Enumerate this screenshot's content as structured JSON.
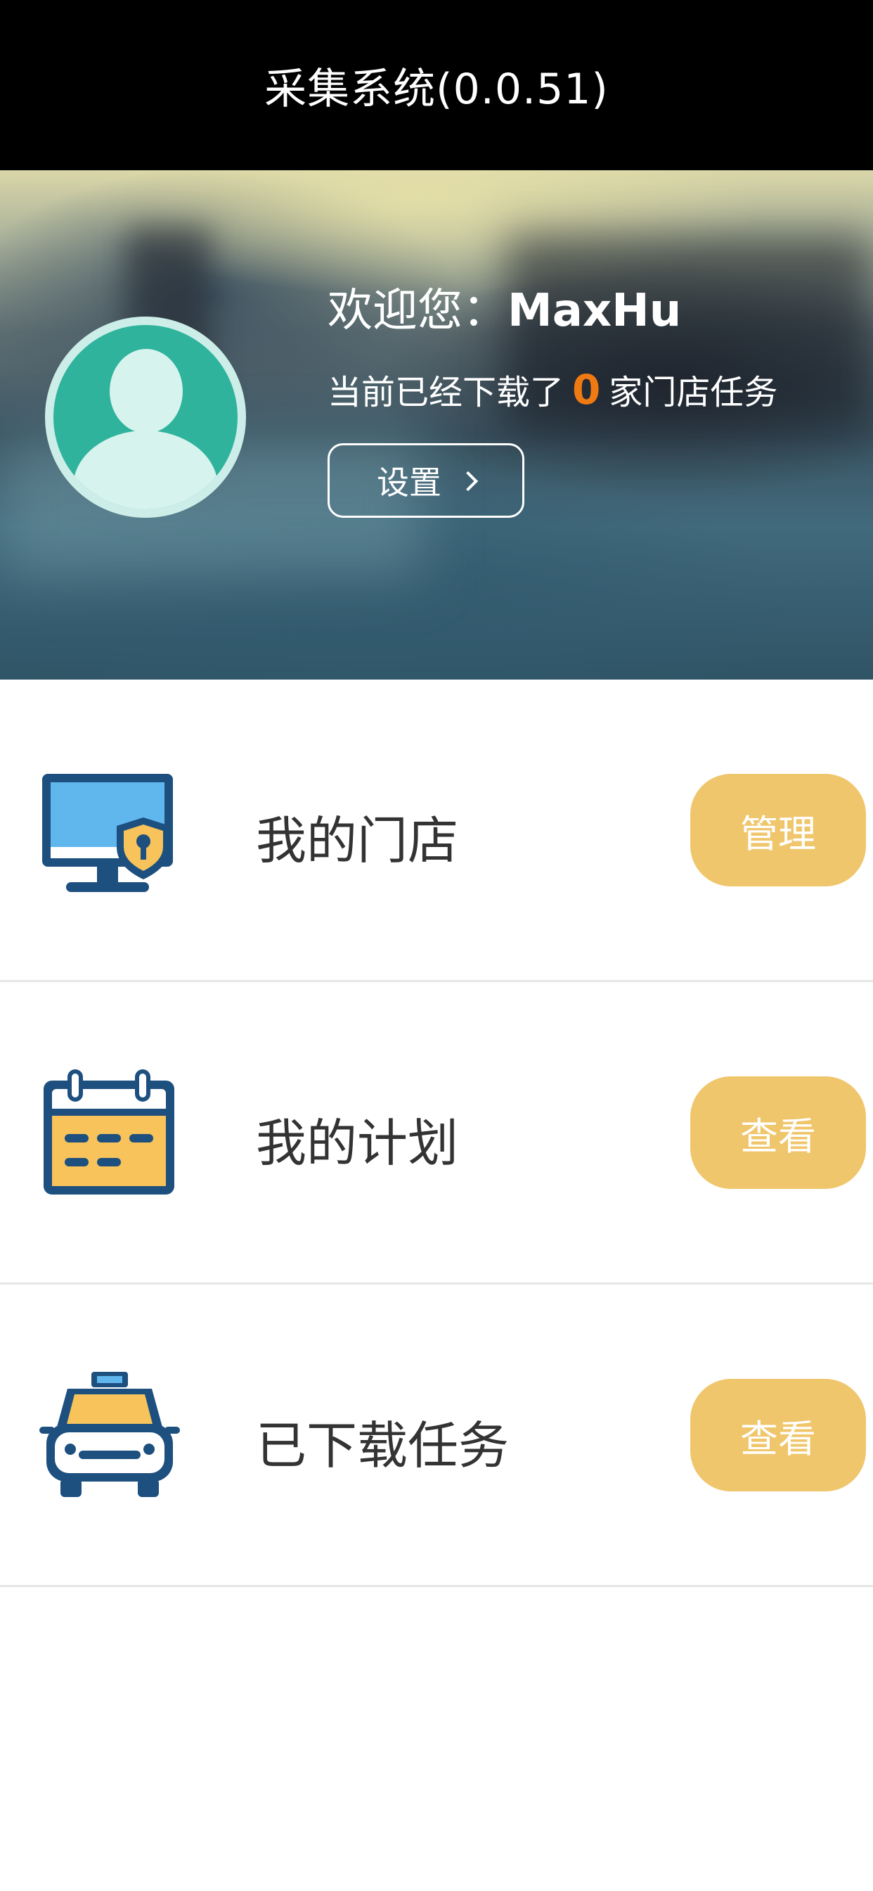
{
  "header": {
    "title": "采集系统(0.0.51)"
  },
  "profile": {
    "welcome_prefix": "欢迎您：",
    "username": "MaxHu",
    "downloaded_prefix": "当前已经下载了",
    "downloaded_count": "0",
    "downloaded_suffix": "家门店任务",
    "settings_label": "设置"
  },
  "menu": [
    {
      "label": "我的门店",
      "action": "管理",
      "icon": "monitor-shield-icon"
    },
    {
      "label": "我的计划",
      "action": "查看",
      "icon": "calendar-icon"
    },
    {
      "label": "已下载任务",
      "action": "查看",
      "icon": "taxi-icon"
    }
  ],
  "colors": {
    "accent_button": "#f0c66c",
    "count_highlight": "#f07a12",
    "titlebar_bg": "#000000",
    "icon_dark_blue": "#1d4f7f",
    "icon_light_blue": "#5fb7ee",
    "icon_yellow": "#f7c35a"
  }
}
